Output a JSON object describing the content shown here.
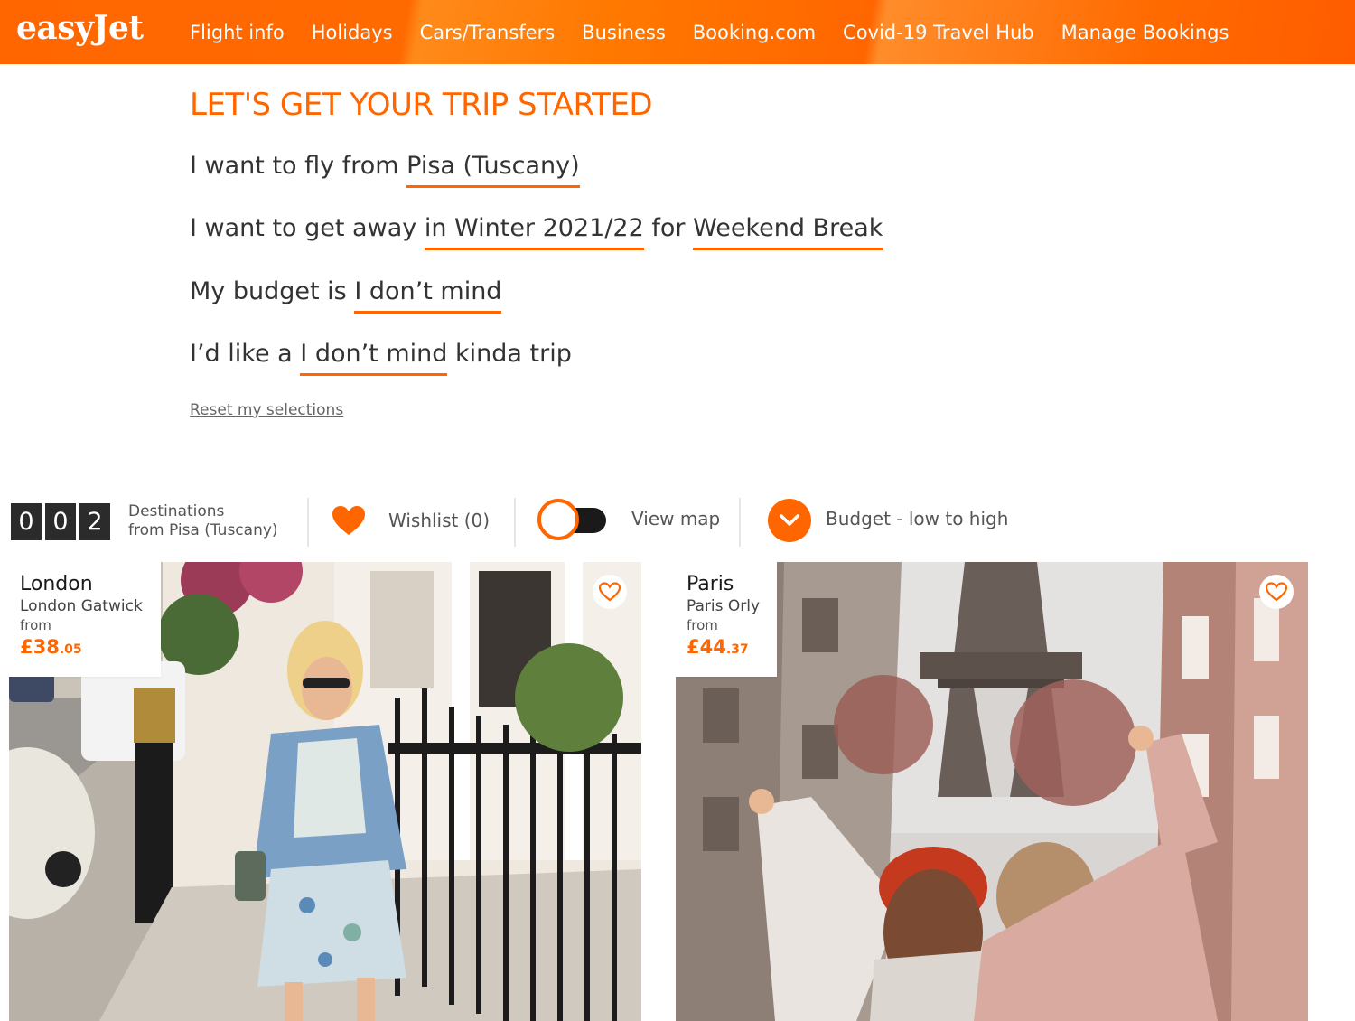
{
  "brand": {
    "logo_text": "easyJet",
    "accent": "#ff6600",
    "dark": "#2b2b2b"
  },
  "nav": {
    "items": [
      {
        "label": "Flight info"
      },
      {
        "label": "Holidays"
      },
      {
        "label": "Cars/Transfers"
      },
      {
        "label": "Business"
      },
      {
        "label": "Booking.com"
      },
      {
        "label": "Covid-19 Travel Hub"
      },
      {
        "label": "Manage Bookings"
      }
    ]
  },
  "builder": {
    "title": "LET'S GET YOUR TRIP STARTED",
    "from_prefix": "I want to fly from",
    "from_value": "Pisa (Tuscany)",
    "when_prefix": "I want to get away",
    "when_value": "in Winter 2021/22",
    "for_text": "for",
    "type_value": "Weekend Break",
    "budget_prefix": "My budget is",
    "budget_value": "I don’t mind",
    "trip_prefix": "I’d like a",
    "trip_value": "I don’t mind",
    "trip_suffix": "kinda trip",
    "reset_label": "Reset my selections"
  },
  "results": {
    "count_digits": [
      "0",
      "0",
      "2"
    ],
    "dest_line1": "Destinations",
    "dest_line2": "from Pisa (Tuscany)",
    "wishlist_label": "Wishlist (0)",
    "wishlist_icon": "heart-icon",
    "map_label": "View map",
    "map_toggle_on": false,
    "sort_label": "Budget - low to high",
    "sort_icon": "chevron-down-icon"
  },
  "cards": [
    {
      "city": "London",
      "airport": "London Gatwick",
      "from": "from",
      "price_main": "£38",
      "price_pence": ".05"
    },
    {
      "city": "Paris",
      "airport": "Paris Orly",
      "from": "from",
      "price_main": "£44",
      "price_pence": ".37"
    }
  ]
}
